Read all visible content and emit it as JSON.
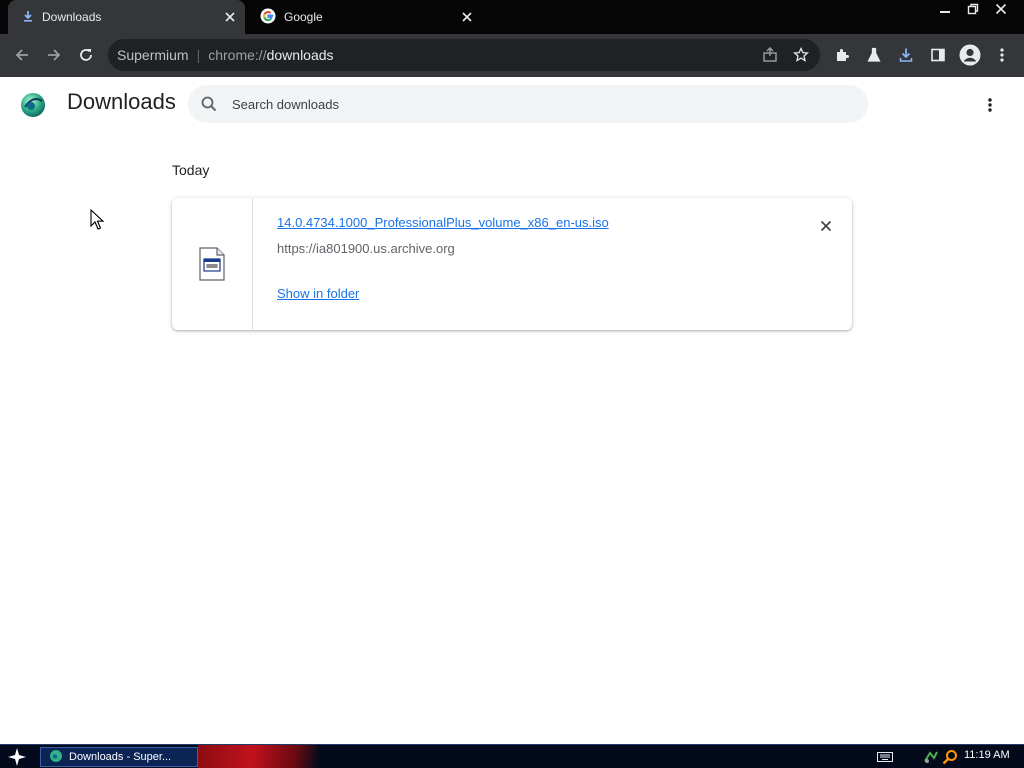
{
  "tabs": [
    {
      "title": "Downloads",
      "icon": "download-icon",
      "active": true
    },
    {
      "title": "Google",
      "icon": "google-icon",
      "active": false
    }
  ],
  "toolbar": {
    "omnibox_chip": "Supermium",
    "omnibox_scheme": "chrome://",
    "omnibox_host": "downloads"
  },
  "page": {
    "title": "Downloads",
    "search_placeholder": "Search downloads"
  },
  "downloads": {
    "date_header": "Today",
    "items": [
      {
        "file_name": "14.0.4734.1000_ProfessionalPlus_volume_x86_en-us.iso",
        "url": "https://ia801900.us.archive.org",
        "action_label": "Show in folder"
      }
    ]
  },
  "taskbar": {
    "task_label": "Downloads - Super...",
    "clock": "11:19 AM"
  },
  "colors": {
    "link": "#1a73e8",
    "tab_active": "#35363a",
    "download_accent": "#8ab4f8",
    "taskbar": "#030a1c"
  }
}
